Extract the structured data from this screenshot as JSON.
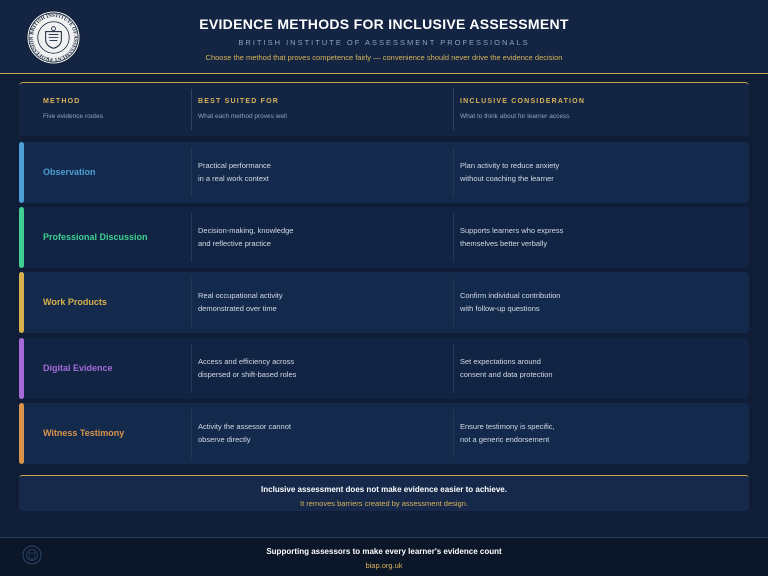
{
  "header": {
    "title": "EVIDENCE METHODS FOR INCLUSIVE ASSESSMENT",
    "subtitle": "BRITISH INSTITUTE OF ASSESSMENT PROFESSIONALS",
    "tagline": "Choose the method that proves competence fairly — convenience should never drive the evidence decision",
    "seal_text": "BRITISH INSTITUTE OF ASSESSMENT PROFESSIONALS"
  },
  "table": {
    "columns": [
      {
        "title": "METHOD",
        "sub": "Five evidence routes"
      },
      {
        "title": "BEST SUITED FOR",
        "sub": "What each method proves well"
      },
      {
        "title": "INCLUSIVE CONSIDERATION",
        "sub": "What to think about for learner access"
      }
    ],
    "rows": [
      {
        "method": "Observation",
        "best_1": "Practical performance",
        "best_2": "in a real work context",
        "incl_1": "Plan activity to reduce anxiety",
        "incl_2": "without coaching the learner",
        "color": "#4d9ed6"
      },
      {
        "method": "Professional Discussion",
        "best_1": "Decision-making, knowledge",
        "best_2": "and reflective practice",
        "incl_1": "Supports learners who express",
        "incl_2": "themselves better verbally",
        "color": "#3fcf91"
      },
      {
        "method": "Work Products",
        "best_1": "Real occupational activity",
        "best_2": "demonstrated over time",
        "incl_1": "Confirm individual contribution",
        "incl_2": "with follow-up questions",
        "color": "#d9b04c"
      },
      {
        "method": "Digital Evidence",
        "best_1": "Access and efficiency across",
        "best_2": "dispersed or shift-based roles",
        "incl_1": "Set expectations around",
        "incl_2": "consent and data protection",
        "color": "#a46ad9"
      },
      {
        "method": "Witness Testimony",
        "best_1": "Activity the assessor cannot",
        "best_2": "observe directly",
        "incl_1": "Ensure testimony is specific,",
        "incl_2": "not a generic endorsement",
        "color": "#d9934a"
      }
    ]
  },
  "note": {
    "line1": "Inclusive assessment does not make evidence easier to achieve.",
    "line2": "It removes barriers created by assessment design."
  },
  "footer": {
    "line1": "Supporting assessors to make every learner's evidence count",
    "url": "biap.org.uk"
  },
  "colors": {
    "background": "#0f1e36",
    "accent_gold": "#c9a54a"
  }
}
